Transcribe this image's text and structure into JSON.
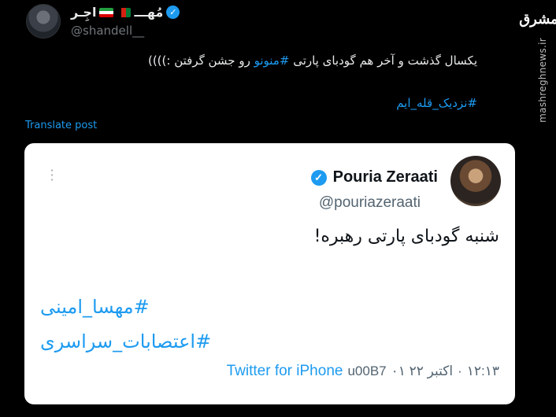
{
  "watermark": {
    "logo": "مشرق",
    "site": "mashreghnews.ir"
  },
  "post": {
    "display_name": "مُهـــ 🇦🇫 🇮🇷 اجِـر",
    "name_text": "اجِـر",
    "name_prefix": "مُهـــ",
    "handle": "@shandell__",
    "text_before": "یکسال گذشت و آخر هم گودبای پارتی ",
    "text_hashtag": "#منونو",
    "text_after": " رو جشن گرفتن :))))",
    "hashtag_line": "#نزدیک_قله_ایم",
    "translate_label": "Translate post"
  },
  "quoted": {
    "name": "Pouria Zeraati",
    "handle": "@pouriazeraati",
    "text": "شنبه گودبای پارتی رهبره!",
    "hashtags": [
      "#مهسا_امینی",
      "#اعتصابات_سراسری"
    ],
    "time": "۱۲:۱۳",
    "date": "۰۱ اکتبر ۲۲",
    "source_code": "u00B7",
    "source": "Twitter for iPhone"
  },
  "colors": {
    "accent": "#1d9bf0",
    "background": "#000000",
    "card": "#ffffff"
  }
}
